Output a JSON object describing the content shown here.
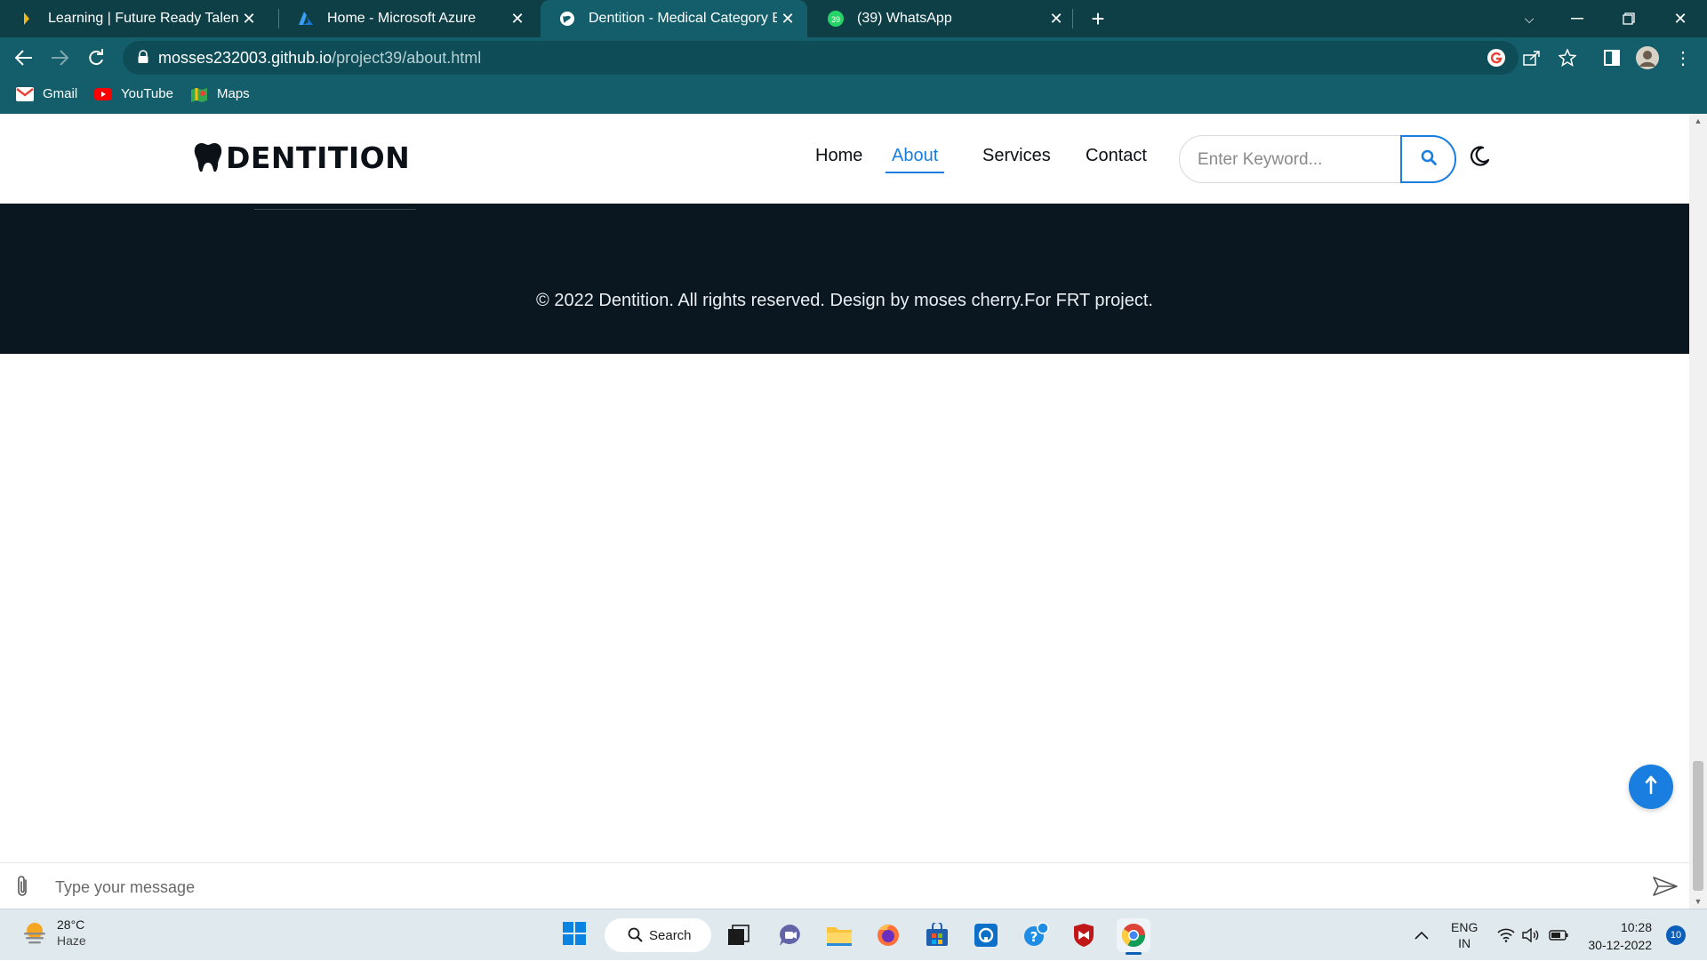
{
  "browser": {
    "tabs": [
      {
        "title": "Learning | Future Ready Talent",
        "icon": "frt-icon"
      },
      {
        "title": "Home - Microsoft Azure",
        "icon": "azure-icon"
      },
      {
        "title": "Dentition - Medical Category Bo",
        "icon": "globe-icon",
        "active": true
      },
      {
        "title": "(39) WhatsApp",
        "icon": "whatsapp-icon"
      }
    ],
    "url_host": "mosses232003.github.io",
    "url_path": "/project39/about.html",
    "bookmarks": [
      {
        "label": "Gmail",
        "icon": "gmail-icon"
      },
      {
        "label": "YouTube",
        "icon": "youtube-icon"
      },
      {
        "label": "Maps",
        "icon": "maps-icon"
      }
    ],
    "whatsapp_badge": "39"
  },
  "site": {
    "brand": "DENTITION",
    "nav": [
      {
        "label": "Home",
        "active": false
      },
      {
        "label": "About",
        "active": true
      },
      {
        "label": "Services",
        "active": false
      },
      {
        "label": "Contact",
        "active": false
      }
    ],
    "search_placeholder": "Enter Keyword...",
    "footer_copyright": "© 2022 Dentition. All rights reserved. Design by moses cherry.For FRT project.",
    "message_placeholder": "Type your message",
    "colors": {
      "accent": "#1a7ee0",
      "footer_bg": "#0b1720",
      "chrome": "#135e6a"
    }
  },
  "taskbar": {
    "temperature": "28°C",
    "weather": "Haze",
    "search_label": "Search",
    "language": "ENG",
    "region": "IN",
    "time": "10:28",
    "date": "30-12-2022",
    "notifications": "10"
  }
}
